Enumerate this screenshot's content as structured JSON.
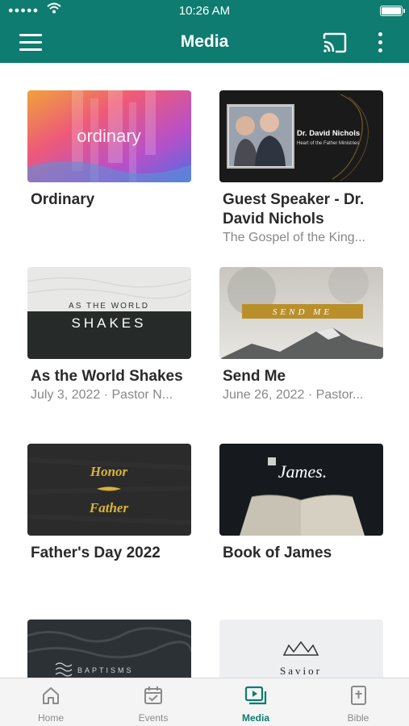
{
  "status_bar": {
    "signal": "●●●●●",
    "time": "10:26 AM"
  },
  "app_bar": {
    "title": "Media"
  },
  "cards": [
    {
      "title": "Ordinary",
      "subtitle": "",
      "thumb_text": "ordinary"
    },
    {
      "title": "Guest Speaker - Dr. David Nichols",
      "subtitle": "The Gospel of the King...",
      "thumb_text": "Dr. David Nichols",
      "thumb_subtext": "Heart of the Father Ministries"
    },
    {
      "title": "As the World Shakes",
      "subtitle": "July 3, 2022 · Pastor N...",
      "thumb_text": "SHAKES",
      "thumb_subtext": "AS THE WORLD"
    },
    {
      "title": "Send Me",
      "subtitle": "June 26, 2022 · Pastor...",
      "thumb_text": "SEND ME"
    },
    {
      "title": "Father's Day 2022",
      "subtitle": "",
      "thumb_text": "Honor",
      "thumb_subtext": "Father"
    },
    {
      "title": "Book of James",
      "subtitle": "",
      "thumb_text": "James."
    },
    {
      "title": "",
      "subtitle": "",
      "thumb_text": "BAPTISMS"
    },
    {
      "title": "",
      "subtitle": "",
      "thumb_text": "Savior"
    }
  ],
  "tab_bar": {
    "tabs": [
      {
        "label": "Home",
        "icon": "home-icon",
        "active": false
      },
      {
        "label": "Events",
        "icon": "calendar-icon",
        "active": false
      },
      {
        "label": "Media",
        "icon": "media-icon",
        "active": true
      },
      {
        "label": "Bible",
        "icon": "bible-icon",
        "active": false
      }
    ]
  },
  "colors": {
    "primary": "#0e7c70",
    "tab_inactive": "#8a8a8a",
    "title_text": "#2a2a2a",
    "subtitle_text": "#888888"
  }
}
